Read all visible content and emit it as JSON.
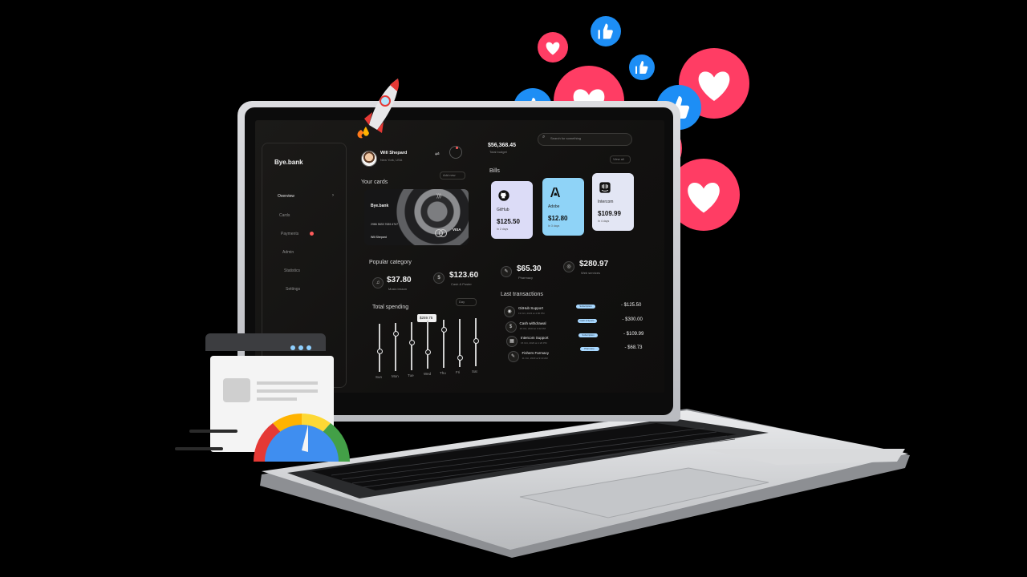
{
  "app": {
    "brand": "Bye.bank"
  },
  "sidebar": {
    "items": [
      {
        "label": "Overview"
      },
      {
        "label": "Cards"
      },
      {
        "label": "Payments"
      },
      {
        "label": "Admin"
      },
      {
        "label": "Statistics"
      },
      {
        "label": "Settings"
      }
    ]
  },
  "user": {
    "name": "Will Shepard",
    "location": "New York, USA"
  },
  "balance": {
    "amount": "$56,368.45",
    "label": "Total budget"
  },
  "search": {
    "placeholder": "Search for something"
  },
  "cards": {
    "title": "Your cards",
    "add_label": "Add new",
    "card": {
      "brand": "Bye.bank",
      "number": "2986  5633  7639  4747",
      "holder": "Will Shepard",
      "network": "VISA"
    }
  },
  "bills": {
    "title": "Bills",
    "view_all": "View all",
    "items": [
      {
        "name": "GitHub",
        "amount": "$125.50",
        "due": "In 2 days",
        "color": "#dcdcf7"
      },
      {
        "name": "Adobe",
        "amount": "$12.80",
        "due": "In 3 days",
        "color": "#8fd3f7"
      },
      {
        "name": "Intercom",
        "amount": "$109.99",
        "due": "In 4 days",
        "color": "#e3e6f4"
      }
    ]
  },
  "popular": {
    "title": "Popular category",
    "items": [
      {
        "amount": "$37.80",
        "label": "Music lesson",
        "icon": "music-icon"
      },
      {
        "amount": "$123.60",
        "label": "Cash & Poster",
        "icon": "cash-icon"
      },
      {
        "amount": "$65.30",
        "label": "Pharmacy",
        "icon": "pill-icon"
      },
      {
        "amount": "$280.97",
        "label": "Web services",
        "icon": "globe-icon"
      }
    ]
  },
  "spending": {
    "title": "Total spending",
    "period": "Day",
    "tooltip": "$259.75",
    "days": [
      "Sun",
      "Mon",
      "Tue",
      "Wed",
      "Thu",
      "Fri",
      "Sat"
    ],
    "levels": [
      0.45,
      0.8,
      0.6,
      0.38,
      0.82,
      0.22,
      0.55
    ]
  },
  "transactions": {
    "title": "Last transactions",
    "items": [
      {
        "name": "GitHub Support",
        "date": "19 Oct, 2023 at 4:00 PM",
        "badge": "Subscription",
        "amount": "- $125.50",
        "icon": "github-icon"
      },
      {
        "name": "Cash withdrawal",
        "date": "16 Oct, 2023 at 3:42 PM",
        "badge": "Cash & Sports",
        "amount": "- $300.00",
        "icon": "cash-icon"
      },
      {
        "name": "Intercom Support",
        "date": "15 Oct, 2023 at 1:20 PM",
        "badge": "Subscription",
        "amount": "- $109.99",
        "icon": "intercom-icon"
      },
      {
        "name": "Fishers Farmacy",
        "date": "11 Oct, 2023 at 9:10 AM",
        "badge": "Pharmacy",
        "amount": "- $68.73",
        "icon": "pill-icon"
      }
    ]
  },
  "decor": {
    "accent_heart": "#ff3d64",
    "accent_like": "#1d8ef5"
  }
}
